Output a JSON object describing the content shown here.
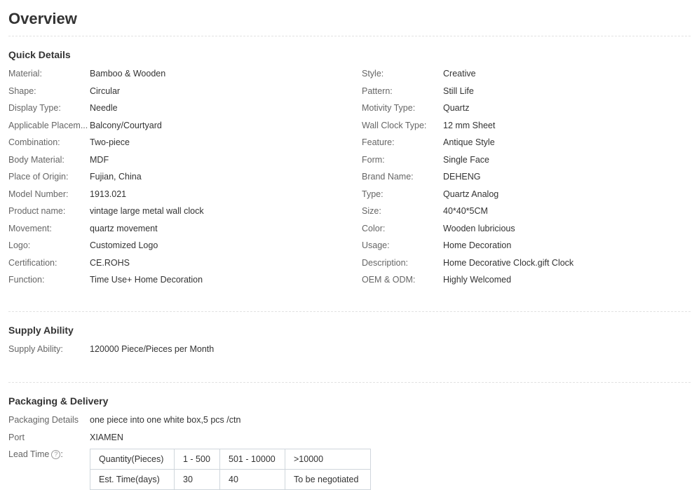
{
  "overview": {
    "title": "Overview"
  },
  "quick_details": {
    "title": "Quick Details",
    "left": [
      {
        "key": "Material:",
        "value": "Bamboo & Wooden"
      },
      {
        "key": "Shape:",
        "value": "Circular"
      },
      {
        "key": "Display Type:",
        "value": "Needle"
      },
      {
        "key": "Applicable Placem...",
        "value": "Balcony/Courtyard"
      },
      {
        "key": "Combination:",
        "value": "Two-piece"
      },
      {
        "key": "Body Material:",
        "value": "MDF"
      },
      {
        "key": "Place of Origin:",
        "value": "Fujian, China"
      },
      {
        "key": "Model Number:",
        "value": "1913.021"
      },
      {
        "key": "Product name:",
        "value": "vintage large metal wall clock"
      },
      {
        "key": "Movement:",
        "value": "quartz movement"
      },
      {
        "key": "Logo:",
        "value": "Customized Logo"
      },
      {
        "key": "Certification:",
        "value": "CE.ROHS"
      },
      {
        "key": "Function:",
        "value": "Time Use+ Home Decoration"
      }
    ],
    "right": [
      {
        "key": "Style:",
        "value": "Creative"
      },
      {
        "key": "Pattern:",
        "value": "Still Life"
      },
      {
        "key": "Motivity Type:",
        "value": "Quartz"
      },
      {
        "key": "Wall Clock Type:",
        "value": "12 mm Sheet"
      },
      {
        "key": "Feature:",
        "value": "Antique Style"
      },
      {
        "key": "Form:",
        "value": "Single Face"
      },
      {
        "key": "Brand Name:",
        "value": "DEHENG"
      },
      {
        "key": "Type:",
        "value": "Quartz Analog"
      },
      {
        "key": "Size:",
        "value": "40*40*5CM"
      },
      {
        "key": "Color:",
        "value": "Wooden lubricious"
      },
      {
        "key": "Usage:",
        "value": "Home Decoration"
      },
      {
        "key": "Description:",
        "value": "Home Decorative Clock.gift Clock"
      },
      {
        "key": "OEM & ODM:",
        "value": "Highly Welcomed"
      }
    ]
  },
  "supply": {
    "title": "Supply Ability",
    "key": "Supply Ability:",
    "value": "120000 Piece/Pieces per Month"
  },
  "packaging": {
    "title": "Packaging & Delivery",
    "details_key": "Packaging Details",
    "details_value": "one piece into one white box,5 pcs /ctn",
    "port_key": "Port",
    "port_value": "XIAMEN",
    "lead_key": "Lead Time",
    "lead_help_icon": "question-circle-icon",
    "lead_table": {
      "row1": [
        "Quantity(Pieces)",
        "1 - 500",
        "501 - 10000",
        ">10000"
      ],
      "row2": [
        "Est. Time(days)",
        "30",
        "40",
        "To be negotiated"
      ]
    }
  }
}
